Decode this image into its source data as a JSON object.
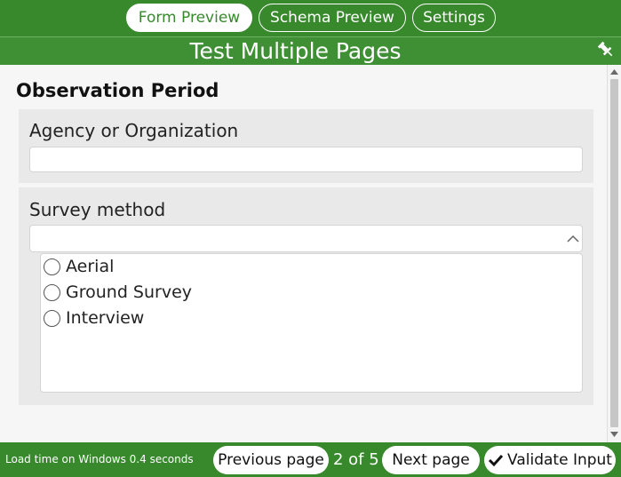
{
  "nav": {
    "tabs": [
      {
        "label": "Form Preview",
        "active": true
      },
      {
        "label": "Schema Preview",
        "active": false
      },
      {
        "label": "Settings",
        "active": false
      }
    ]
  },
  "header": {
    "title": "Test Multiple Pages",
    "pin_icon": "pin-icon"
  },
  "page": {
    "title": "Observation Period",
    "fields": {
      "agency": {
        "label": "Agency or Organization",
        "value": ""
      },
      "survey_method": {
        "label": "Survey method",
        "value": "",
        "options": [
          "Aerial",
          "Ground Survey",
          "Interview"
        ]
      }
    }
  },
  "footer": {
    "load_time": "Load time on Windows 0.4 seconds",
    "previous_label": "Previous page",
    "page_indicator": "2 of 5",
    "next_label": "Next page",
    "validate_label": "Validate Input",
    "validate_icon": "check-icon"
  },
  "colors": {
    "brand_green": "#37892c",
    "panel_gray": "#e9e9e9"
  }
}
